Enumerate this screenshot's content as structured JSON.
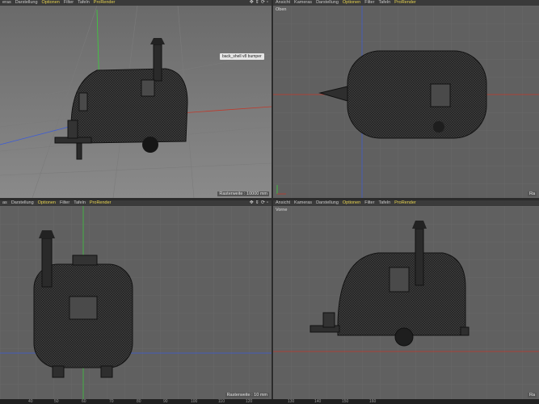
{
  "viewports": [
    {
      "menu": [
        "eras",
        "Darstellung",
        "Optionen",
        "Filter",
        "Tafeln",
        "ProRender"
      ],
      "highlighted": [
        "Optionen",
        "ProRender"
      ],
      "label": "",
      "footer": "Rasterweite : 10000 mm",
      "object_tag": "back_shell v8 bumper"
    },
    {
      "menu": [
        "Ansicht",
        "Kameras",
        "Darstellung",
        "Optionen",
        "Filter",
        "Tafeln",
        "ProRender"
      ],
      "highlighted": [
        "Optionen",
        "ProRender"
      ],
      "label": "Oben",
      "footer": "Ra"
    },
    {
      "menu": [
        "as",
        "Darstellung",
        "Optionen",
        "Filter",
        "Tafeln",
        "ProRender"
      ],
      "highlighted": [
        "Optionen",
        "ProRender"
      ],
      "label": "",
      "footer": "Rasterweite : 10 mm"
    },
    {
      "menu": [
        "Ansicht",
        "Kameras",
        "Darstellung",
        "Optionen",
        "Filter",
        "Tafeln",
        "ProRender"
      ],
      "highlighted": [
        "Optionen",
        "ProRender"
      ],
      "label": "Vorne",
      "footer": "Ra"
    }
  ],
  "ruler": [
    "40",
    "50",
    "60",
    "70",
    "80",
    "90",
    "100",
    "110",
    "120",
    "130",
    "140",
    "150",
    "160"
  ],
  "colors": {
    "panel_bg": "#5f5f5f",
    "header_bg": "#3a3a3a",
    "highlight": "#e7d34f",
    "axis_x": "#c0392b",
    "axis_y": "#2ecc40",
    "axis_z": "#3b5bd9"
  },
  "icons": [
    "move-icon",
    "zoom-icon",
    "rotate-icon",
    "maximize-icon"
  ]
}
